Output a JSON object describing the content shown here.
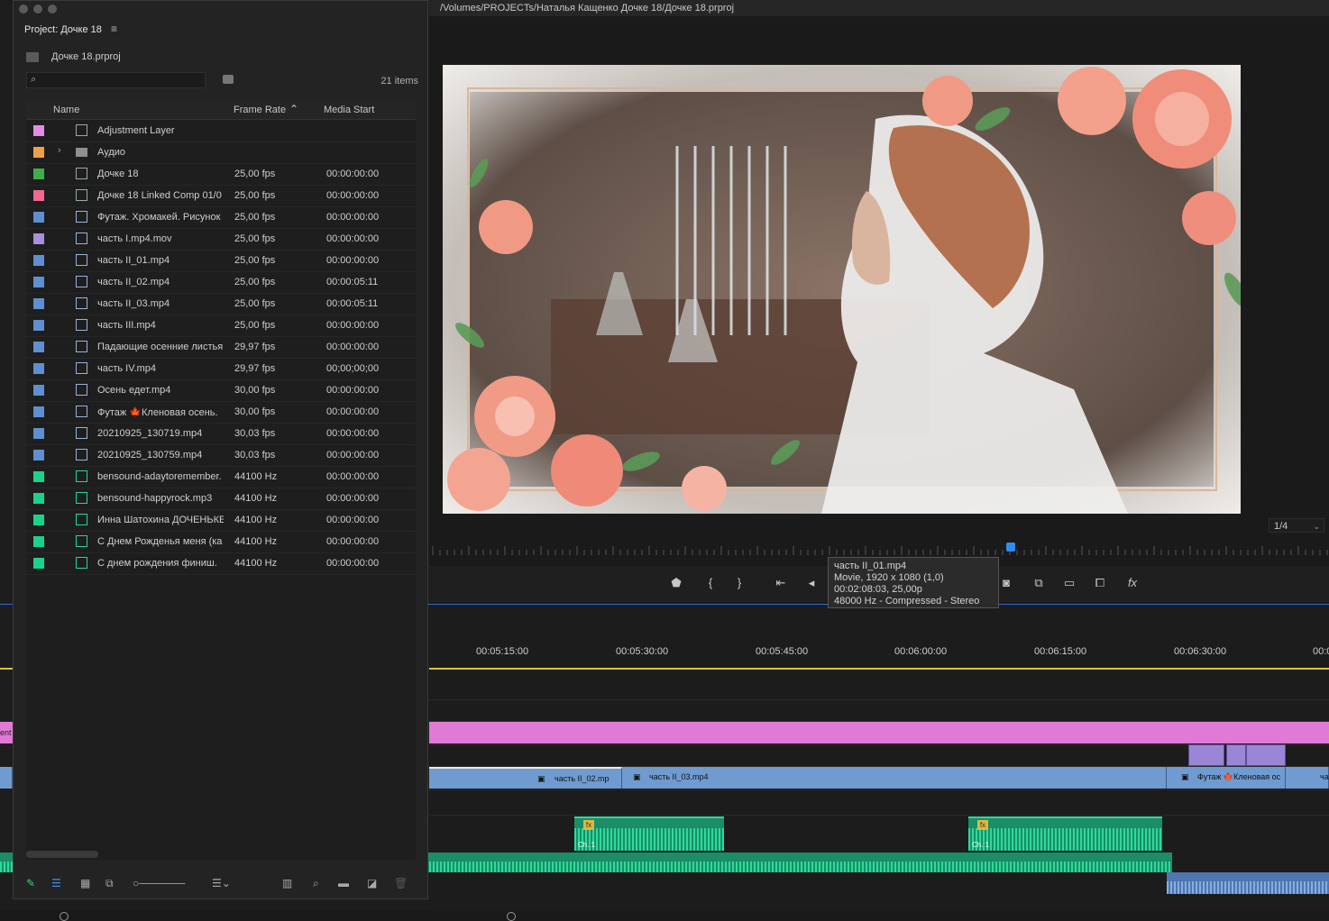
{
  "window_path": "/Volumes/PROJECTs/Наталья Кащенко Дочке 18/Дочке 18.prproj",
  "project": {
    "title": "Project: Дочке 18",
    "file": "Дочке 18.prproj",
    "items_count": "21 items",
    "columns": {
      "name": "Name",
      "frame_rate": "Frame Rate",
      "media_start": "Media Start"
    },
    "rows": [
      {
        "color": "#e58be6",
        "icon": "adjustment-layer-icon",
        "name": "Adjustment Layer",
        "frame_rate": "",
        "media_start": ""
      },
      {
        "color": "#f0a044",
        "icon": "folder-icon",
        "name": "Аудио",
        "frame_rate": "",
        "media_start": ""
      },
      {
        "color": "#3fae4a",
        "icon": "sequence-icon",
        "name": "Дочке 18",
        "frame_rate": "25,00 fps",
        "media_start": "00:00:00:00"
      },
      {
        "color": "#f2688f",
        "icon": "linked-comp-icon",
        "name": "Дочке 18 Linked Comp 01/0",
        "frame_rate": "25,00 fps",
        "media_start": "00:00:00:00"
      },
      {
        "color": "#5f8fd0",
        "icon": "video-clip-icon",
        "name": "Футаж. Хромакей. Рисунок",
        "frame_rate": "25,00 fps",
        "media_start": "00:00:00:00"
      },
      {
        "color": "#a98ee0",
        "icon": "video-clip-icon",
        "name": "часть I.mp4.mov",
        "frame_rate": "25,00 fps",
        "media_start": "00:00:00:00"
      },
      {
        "color": "#5f8fd0",
        "icon": "video-clip-icon",
        "name": "часть II_01.mp4",
        "frame_rate": "25,00 fps",
        "media_start": "00:00:00:00"
      },
      {
        "color": "#5f8fd0",
        "icon": "video-clip-icon",
        "name": "часть II_02.mp4",
        "frame_rate": "25,00 fps",
        "media_start": "00:00:05:11"
      },
      {
        "color": "#5f8fd0",
        "icon": "video-clip-icon",
        "name": "часть II_03.mp4",
        "frame_rate": "25,00 fps",
        "media_start": "00:00:05:11"
      },
      {
        "color": "#5f8fd0",
        "icon": "video-clip-icon",
        "name": "часть III.mp4",
        "frame_rate": "25,00 fps",
        "media_start": "00:00:00:00"
      },
      {
        "color": "#5f8fd0",
        "icon": "video-clip-icon",
        "name": "Падающие осенние листья",
        "frame_rate": "29,97 fps",
        "media_start": "00:00:00:00"
      },
      {
        "color": "#5f8fd0",
        "icon": "video-clip-icon",
        "name": "часть IV.mp4",
        "frame_rate": "29,97 fps",
        "media_start": "00;00;00;00"
      },
      {
        "color": "#5f8fd0",
        "icon": "video-clip-icon",
        "name": "Осень едет.mp4",
        "frame_rate": "30,00 fps",
        "media_start": "00:00:00:00"
      },
      {
        "color": "#5f8fd0",
        "icon": "video-clip-icon",
        "name": "Футаж 🍁Кленовая осень.",
        "frame_rate": "30,00 fps",
        "media_start": "00:00:00:00"
      },
      {
        "color": "#5f8fd0",
        "icon": "video-clip-icon",
        "name": "20210925_130719.mp4",
        "frame_rate": "30,03 fps",
        "media_start": "00:00:00:00"
      },
      {
        "color": "#5f8fd0",
        "icon": "video-clip-icon",
        "name": "20210925_130759.mp4",
        "frame_rate": "30,03 fps",
        "media_start": "00:00:00:00"
      },
      {
        "color": "#19d38c",
        "icon": "audio-clip-icon",
        "name": "bensound-adaytoremember.",
        "frame_rate": "44100 Hz",
        "media_start": "00:00:00:00"
      },
      {
        "color": "#19d38c",
        "icon": "audio-clip-icon",
        "name": "bensound-happyrock.mp3",
        "frame_rate": "44100 Hz",
        "media_start": "00:00:00:00"
      },
      {
        "color": "#19d38c",
        "icon": "audio-clip-icon",
        "name": "Инна Шатохина ДОЧЕНЬКЕ",
        "frame_rate": "44100 Hz",
        "media_start": "00:00:00:00"
      },
      {
        "color": "#19d38c",
        "icon": "audio-clip-icon",
        "name": "С Днем Рожденья меня (ка",
        "frame_rate": "44100 Hz",
        "media_start": "00:00:00:00"
      },
      {
        "color": "#19d38c",
        "icon": "audio-clip-icon",
        "name": "С днем рождения финиш.",
        "frame_rate": "44100 Hz",
        "media_start": "00:00:00:00"
      }
    ]
  },
  "monitor": {
    "zoom": "1/4",
    "tooltip": [
      "часть II_01.mp4",
      "Movie, 1920 x 1080 (1,0)",
      "00:02:08:03, 25,00p",
      "48000 Hz - Compressed - Stereo"
    ]
  },
  "timeline": {
    "timecodes": [
      "00:05:15:00",
      "00:05:30:00",
      "00:05:45:00",
      "00:06:00:00",
      "00:06:15:00",
      "00:06:30:00",
      "00:0"
    ],
    "clips": {
      "pink_left_label": "ent",
      "v_clip_1": "часть II_02.mp",
      "v_clip_2": "часть II_03.mp4",
      "v_clip_3": "Футаж 🍁Кленовая ос",
      "v_clip_4": "ча",
      "a_ch1": "Ch. 1",
      "a_ch2": "Ch. 1"
    }
  }
}
